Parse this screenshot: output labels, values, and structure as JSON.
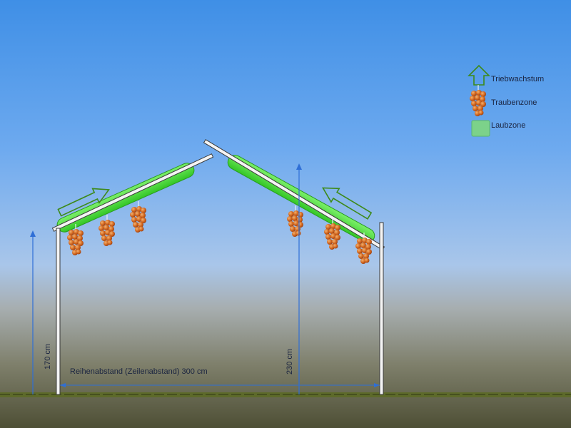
{
  "legend": {
    "shoot_growth": "Triebwachstum",
    "grape_zone": "Traubenzone",
    "leaf_zone": "Laubzone"
  },
  "dimensions": {
    "left_height": "170  cm",
    "right_height": "230  cm",
    "row_spacing": "Reihenabstand (Zeilenabstand) 300 cm"
  },
  "colors": {
    "sky_top": "#3f8fe6",
    "sky_mid": "#a9c6ea",
    "ground": "#56573c",
    "foliage": "#47e23a",
    "arrow": "#2f6fd6",
    "grape": "#c9591c"
  }
}
